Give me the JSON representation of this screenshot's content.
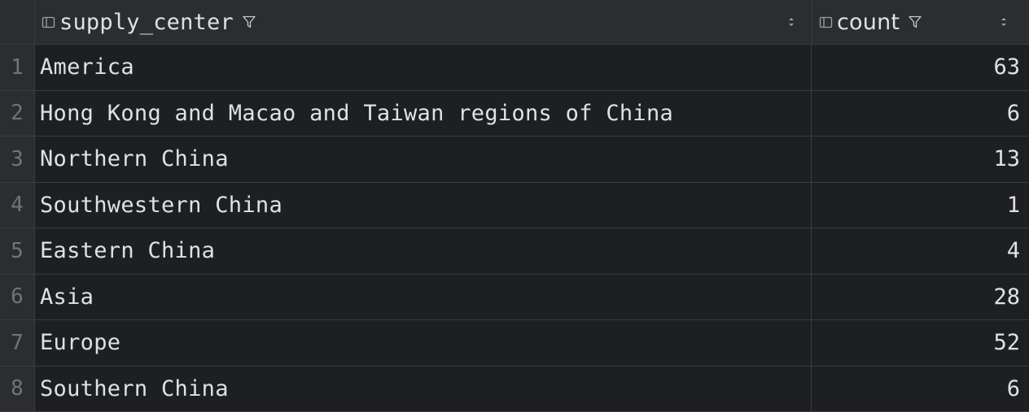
{
  "table": {
    "columns": [
      {
        "name": "supply_center"
      },
      {
        "name": "count"
      }
    ],
    "rows": [
      {
        "n": "1",
        "supply_center": "America",
        "count": "63"
      },
      {
        "n": "2",
        "supply_center": "Hong Kong and Macao and Taiwan regions of China",
        "count": "6"
      },
      {
        "n": "3",
        "supply_center": "Northern China",
        "count": "13"
      },
      {
        "n": "4",
        "supply_center": "Southwestern China",
        "count": "1"
      },
      {
        "n": "5",
        "supply_center": "Eastern China",
        "count": "4"
      },
      {
        "n": "6",
        "supply_center": "Asia",
        "count": "28"
      },
      {
        "n": "7",
        "supply_center": "Europe",
        "count": "52"
      },
      {
        "n": "8",
        "supply_center": "Southern China",
        "count": "6"
      }
    ]
  },
  "icons": {
    "column": "column-icon",
    "filter": "filter-icon",
    "sort": "sort-icon"
  },
  "colors": {
    "background": "#1e1f22",
    "header": "#2b2d30",
    "grid_line": "#393b40",
    "text": "#dfe1e5",
    "row_number": "#6f737a"
  }
}
